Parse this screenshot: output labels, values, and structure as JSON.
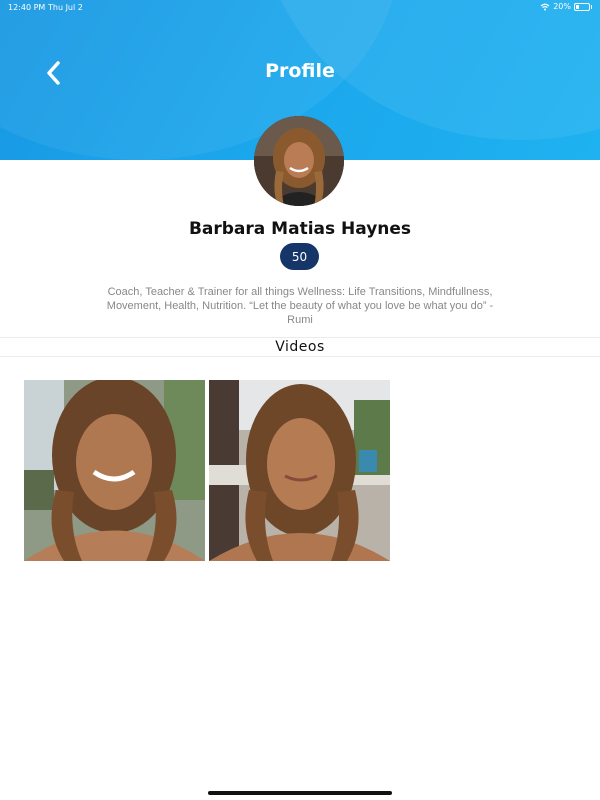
{
  "status_bar": {
    "time": "12:40 PM",
    "date": "Thu Jul 2",
    "battery": "20%"
  },
  "header": {
    "title": "Profile",
    "back_icon": "chevron-left-icon",
    "accent_color": "#1ba6ec"
  },
  "profile": {
    "name": "Barbara Matias Haynes",
    "points": "50",
    "bio": "Coach, Teacher & Trainer for all things Wellness: Life Transitions, Mindfullness, Movement, Health, Nutrition.     “Let the beauty of what you love be what you do” -Rumi",
    "badge_color": "#163569"
  },
  "videos": {
    "section_title": "Videos"
  }
}
